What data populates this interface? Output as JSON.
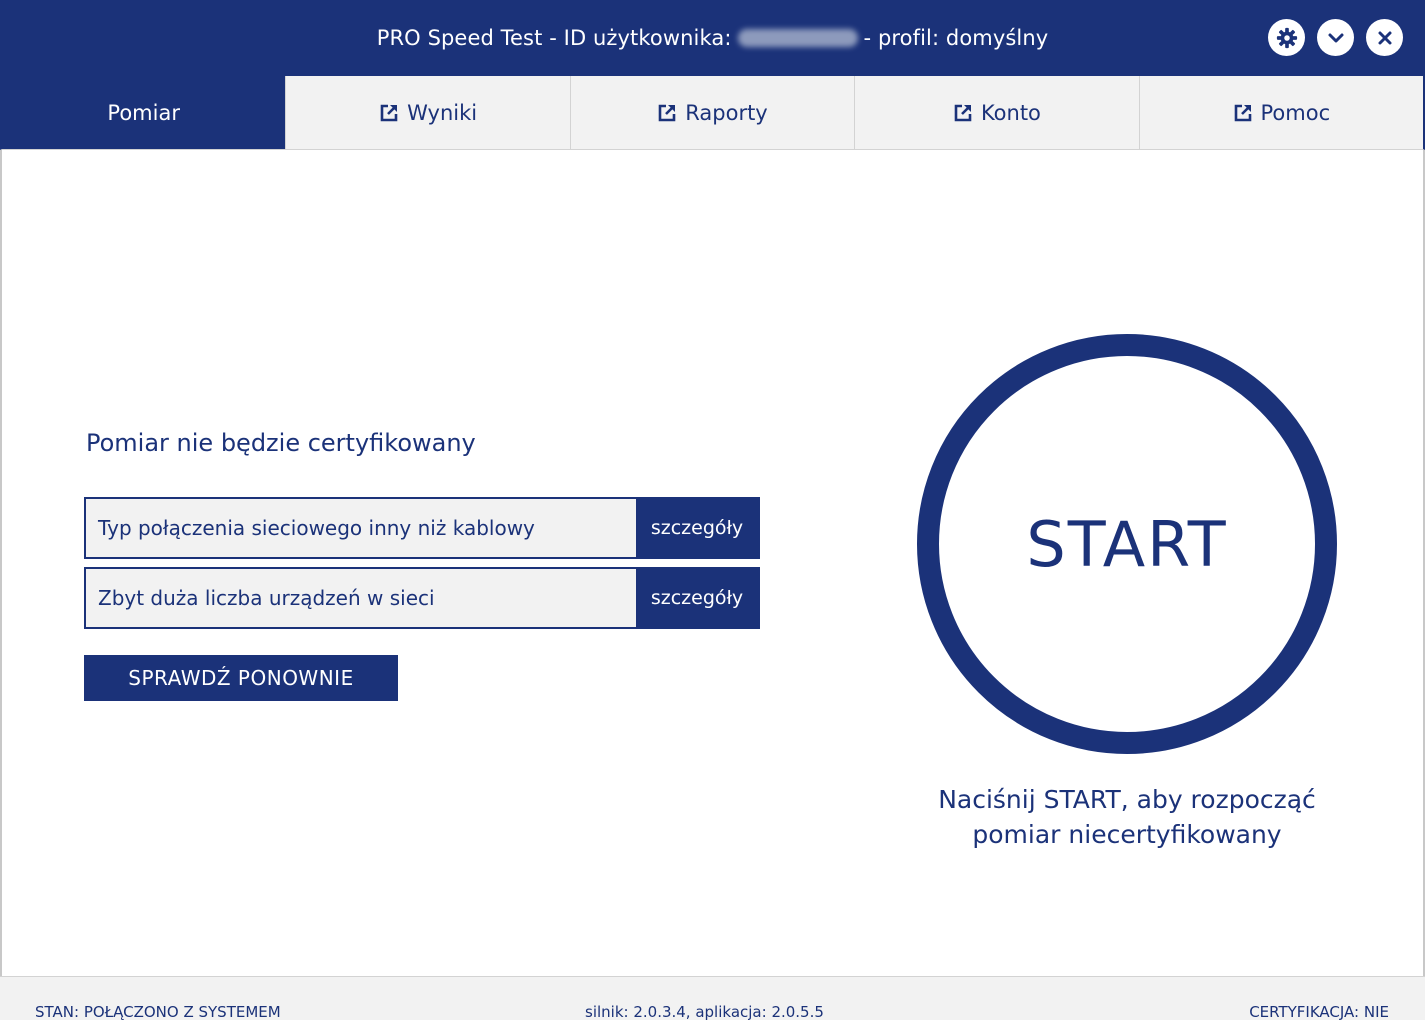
{
  "window": {
    "title_prefix": "PRO Speed Test - ID użytkownika:",
    "title_suffix": "- profil: domyślny",
    "buttons": [
      {
        "name": "settings-button",
        "icon": "gear-icon"
      },
      {
        "name": "minimize-button",
        "icon": "chevron-down-icon"
      },
      {
        "name": "close-button",
        "icon": "close-icon"
      }
    ]
  },
  "tabs": [
    {
      "label": "Pomiar",
      "active": true,
      "external": false
    },
    {
      "label": "Wyniki",
      "active": false,
      "external": true
    },
    {
      "label": "Raporty",
      "active": false,
      "external": true
    },
    {
      "label": "Konto",
      "active": false,
      "external": true
    },
    {
      "label": "Pomoc",
      "active": false,
      "external": true
    }
  ],
  "certification": {
    "heading": "Pomiar nie będzie certyfikowany",
    "issues": [
      {
        "text": "Typ połączenia sieciowego inny niż kablowy",
        "button": "szczegóły"
      },
      {
        "text": "Zbyt duża liczba urządzeń w sieci",
        "button": "szczegóły"
      }
    ],
    "recheck_label": "SPRAWDŹ PONOWNIE"
  },
  "start": {
    "label": "START",
    "hint_line1": "Naciśnij START, aby rozpocząć",
    "hint_line2": "pomiar niecertyfikowany"
  },
  "status": {
    "state": "STAN: POŁĄCZONO Z SYSTEMEM",
    "versions": "silnik: 2.0.3.4, aplikacja: 2.0.5.5",
    "certification": "CERTYFIKACJA: NIE"
  },
  "colors": {
    "brand": "#1b3279",
    "panel": "#f2f2f2"
  }
}
